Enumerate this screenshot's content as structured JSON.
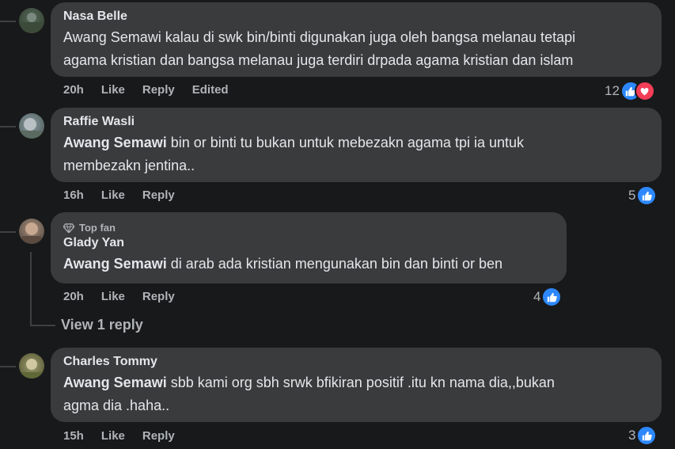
{
  "comments": [
    {
      "author": "Nasa Belle",
      "line1": "Awang Semawi kalau di swk bin/binti digunakan juga oleh bangsa melanau tetapi",
      "line2": "agama kristian dan bangsa melanau juga terdiri drpada agama kristian dan islam",
      "time": "20h",
      "like": "Like",
      "reply": "Reply",
      "edited": "Edited",
      "reaction_count": "12"
    },
    {
      "author": "Raffie Wasli",
      "mention": "Awang Semawi",
      "line1_rest": " bin or binti tu bukan untuk mebezakn agama tpi ia untuk",
      "line2": "membezakn jentina..",
      "time": "16h",
      "like": "Like",
      "reply": "Reply",
      "reaction_count": "5"
    },
    {
      "badge": "Top fan",
      "author": "Glady Yan",
      "mention": "Awang Semawi",
      "line1_rest": " di arab ada kristian mengunakan bin dan binti or ben",
      "time": "20h",
      "like": "Like",
      "reply": "Reply",
      "reaction_count": "4",
      "view_replies": "View 1 reply"
    },
    {
      "author": "Charles Tommy",
      "mention": "Awang Semawi",
      "line1_rest": " sbb kami org sbh srwk bfikiran positif .itu kn nama dia,,bukan",
      "line2": "agma dia .haha..",
      "time": "15h",
      "like": "Like",
      "reply": "Reply",
      "reaction_count": "3"
    }
  ],
  "colors": {
    "background": "#18191a",
    "bubble": "#3a3b3c",
    "like_blue": "#2d88ff",
    "love_red": "#f33e58",
    "secondary_text": "#b0b3b8"
  }
}
